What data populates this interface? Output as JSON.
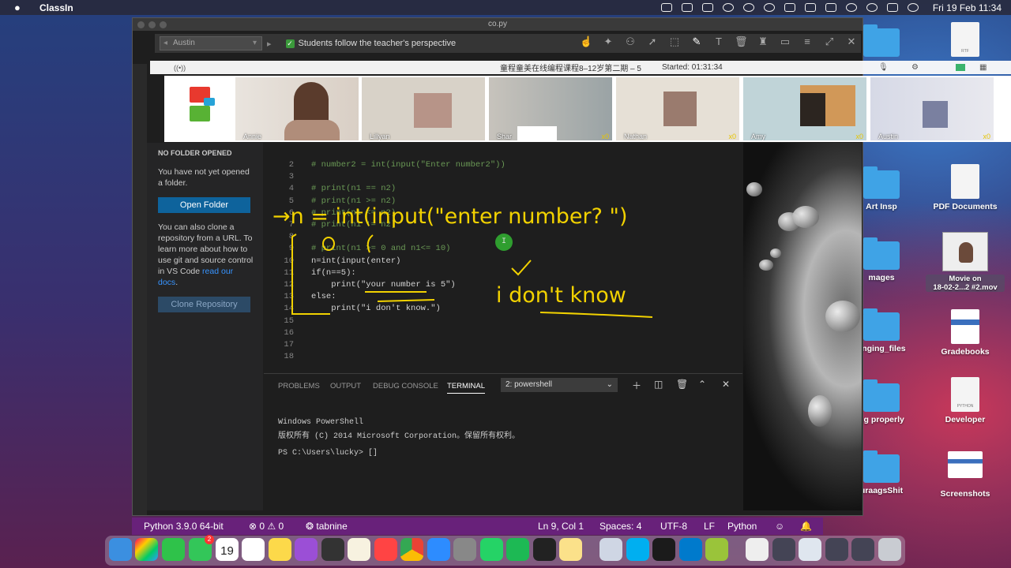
{
  "menubar": {
    "app_name": "ClassIn",
    "clock": "Fri 19 Feb  11:34"
  },
  "desktop_icons": [
    {
      "label": "Art Insp"
    },
    {
      "label": "PDF Documents"
    },
    {
      "label": "mages"
    },
    {
      "label": "Movie on\n18-02-2...2 #2.mov"
    },
    {
      "label": "anging_files"
    },
    {
      "label": "Gradebooks"
    },
    {
      "label": "ng properly"
    },
    {
      "label": "Developer"
    },
    {
      "label": "uraagsShit"
    },
    {
      "label": "Screenshots"
    }
  ],
  "window": {
    "title": "co.py"
  },
  "classin": {
    "student_select": "Austin",
    "follow_label": "Students follow the teacher's perspective",
    "room_title": "童程童美在线编程课程8–12岁第二期 – 5",
    "started": "Started: 01:31:34",
    "participants": [
      {
        "name": "Annie",
        "count": ""
      },
      {
        "name": "Lillyan",
        "count": ""
      },
      {
        "name": "Shar",
        "count": "x0"
      },
      {
        "name": "Nathan",
        "count": "x0"
      },
      {
        "name": "Amy",
        "count": "x0"
      },
      {
        "name": "Austin",
        "count": "x0"
      }
    ]
  },
  "sidebar": {
    "section": "NO FOLDER OPENED",
    "no_folder_text": "You have not yet opened a folder.",
    "open_folder": "Open Folder",
    "clone_text": "You can also clone a repository from a URL. To learn more about how to use git and source control in VS Code ",
    "docs_link": "read our docs",
    "clone_button": "Clone Repository"
  },
  "editor": {
    "lines": [
      {
        "num": "2",
        "code": "# number2 = int(input(\"Enter number2\"))",
        "kind": "cm"
      },
      {
        "num": "3",
        "code": "",
        "kind": ""
      },
      {
        "num": "4",
        "code": "# print(n1 == n2)",
        "kind": "cm"
      },
      {
        "num": "5",
        "code": "# print(n1 >= n2)",
        "kind": "cm"
      },
      {
        "num": "6",
        "code": "# print(n1 <= n2)",
        "kind": "cm"
      },
      {
        "num": "7",
        "code": "# print(n1 != n2)",
        "kind": "cm"
      },
      {
        "num": "8",
        "code": "",
        "kind": ""
      },
      {
        "num": "9",
        "code": "# print(n1 >= 0 and n1<= 10)",
        "kind": "cm"
      },
      {
        "num": "10",
        "code": "n=int(input(enter)",
        "kind": "plain"
      },
      {
        "num": "11",
        "code": "if(n==5):",
        "kind": "plain"
      },
      {
        "num": "12",
        "code": "    print(\"your number is 5\")",
        "kind": "plain"
      },
      {
        "num": "13",
        "code": "else:",
        "kind": "plain"
      },
      {
        "num": "14",
        "code": "    print(\"i don't know.\")",
        "kind": "plain"
      },
      {
        "num": "15",
        "code": "",
        "kind": ""
      },
      {
        "num": "16",
        "code": "",
        "kind": ""
      },
      {
        "num": "17",
        "code": "",
        "kind": ""
      },
      {
        "num": "18",
        "code": "",
        "kind": ""
      }
    ]
  },
  "panel": {
    "tabs": [
      "PROBLEMS",
      "OUTPUT",
      "DEBUG CONSOLE",
      "TERMINAL"
    ],
    "terminal_select": "2: powershell",
    "terminal_lines": [
      "Windows PowerShell",
      "版权所有 (C) 2014 Microsoft Corporation。保留所有权利。",
      "",
      "PS C:\\Users\\lucky> []"
    ]
  },
  "annotations": {
    "line1": "→n = int(input(\"enter number? \")",
    "line2": "i don't know"
  },
  "statusbar": {
    "python": "Python 3.9.0 64-bit",
    "problems": "⊗ 0 ⚠ 0",
    "tabnine": "tabnine",
    "position": "Ln 9, Col 1",
    "spaces": "Spaces: 4",
    "encoding": "UTF-8",
    "eol": "LF",
    "language": "Python"
  },
  "dock": {
    "calendar_day": "19",
    "messages_badge": "2"
  },
  "colors": {
    "statusbar": "#68217a",
    "button": "#0e639c",
    "annotation": "#f2d200"
  }
}
